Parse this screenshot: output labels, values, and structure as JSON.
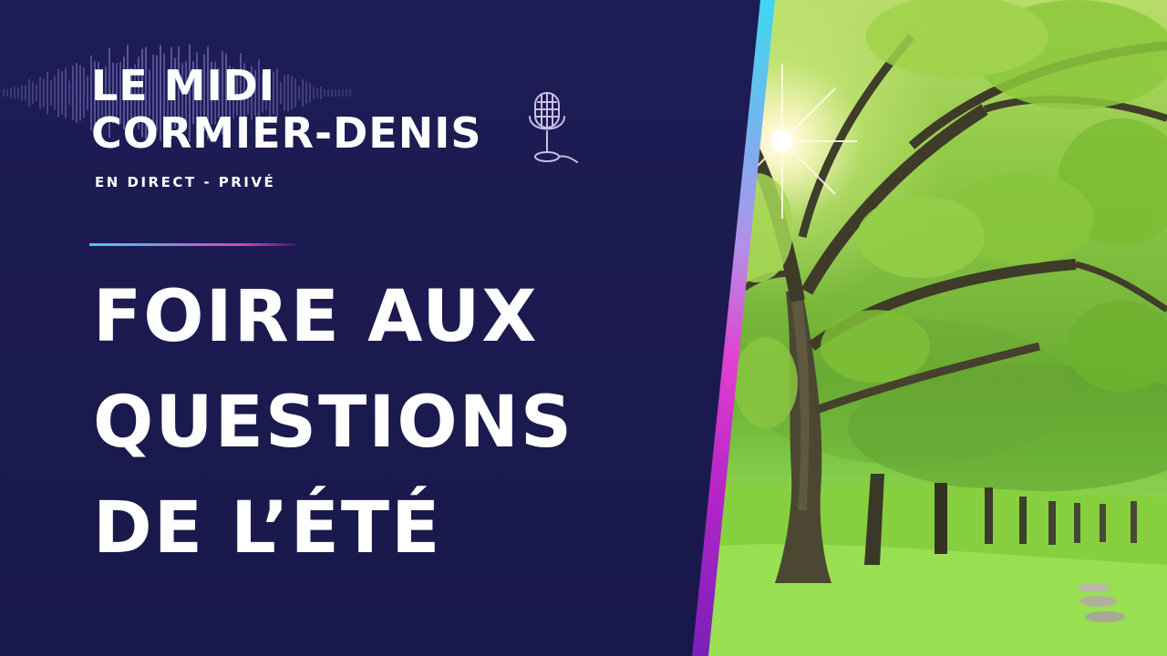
{
  "show": {
    "title_line1": "LE MIDI",
    "title_line2": "CORMIER-DENIS",
    "subtitle": "EN DIRECT - PRIVÉ"
  },
  "episode": {
    "title_line1": "FOIRE AUX",
    "title_line2": "QUESTIONS",
    "title_line3": "DE L’ÉTÉ"
  },
  "icons": {
    "microphone": "microphone-icon",
    "soundwave": "soundwave-graphic"
  },
  "colors": {
    "background": "#1b1a4f",
    "text": "#ffffff",
    "accent_cyan": "#49cfee",
    "accent_magenta": "#d63fd0",
    "accent_purple": "#7a1fb8"
  }
}
